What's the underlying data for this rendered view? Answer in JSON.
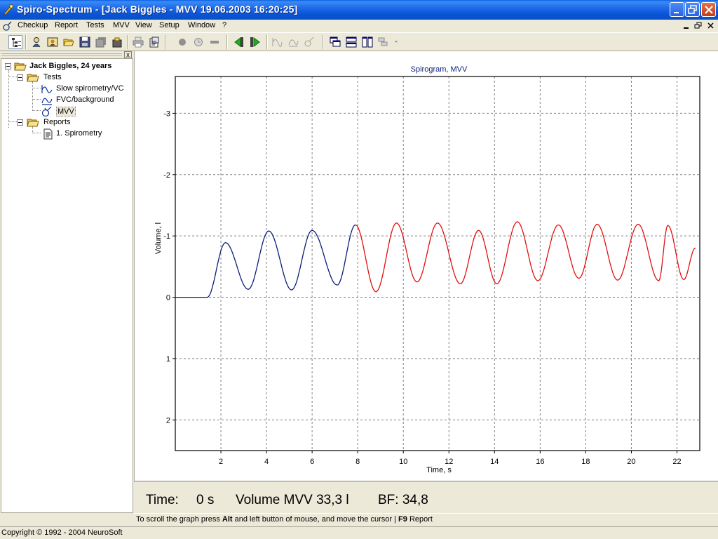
{
  "window": {
    "title": "Spiro-Spectrum - [Jack Biggles - MVV 19.06.2003 16:20:25]"
  },
  "menu": {
    "items": [
      "Checkup",
      "Report",
      "Tests",
      "MVV",
      "View",
      "Setup",
      "Window",
      "?"
    ]
  },
  "tree": {
    "patient": "Jack Biggles, 24 years",
    "tests_folder": "Tests",
    "tests": [
      "Slow spirometry/VC",
      "FVC/background",
      "MVV"
    ],
    "reports_folder": "Reports",
    "reports": [
      "1. Spirometry"
    ],
    "close_label": "x"
  },
  "chart_data": {
    "type": "line",
    "title": "Spirogram, MVV",
    "xlabel": "Time, s",
    "ylabel": "Volume, l",
    "x_ticks": [
      "2",
      "4",
      "6",
      "8",
      "10",
      "12",
      "14",
      "16",
      "18",
      "20",
      "22"
    ],
    "y_ticks": [
      "-3",
      "-2",
      "-1",
      "0",
      "1",
      "2"
    ],
    "xlim": [
      0,
      23
    ],
    "ylim": [
      2.5,
      -3.6
    ],
    "y_inverted": true,
    "grid": true,
    "colors": {
      "series1": "#0a1f7a",
      "series2": "#e01010",
      "title": "#0a1f7a"
    },
    "series": [
      {
        "points": [
          [
            0,
            0
          ],
          [
            1.4,
            0
          ],
          [
            2.2,
            -0.89
          ],
          [
            3.2,
            -0.13
          ],
          [
            4.1,
            -1.08
          ],
          [
            5.1,
            -0.12
          ],
          [
            6.0,
            -1.09
          ],
          [
            7.1,
            -0.2
          ],
          [
            7.9,
            -1.18
          ]
        ]
      },
      {
        "points": [
          [
            7.9,
            -1.18
          ],
          [
            8.8,
            -0.09
          ],
          [
            9.7,
            -1.21
          ],
          [
            10.6,
            -0.25
          ],
          [
            11.5,
            -1.21
          ],
          [
            12.5,
            -0.22
          ],
          [
            13.3,
            -1.09
          ],
          [
            14.1,
            -0.22
          ],
          [
            15.0,
            -1.23
          ],
          [
            15.9,
            -0.27
          ],
          [
            16.8,
            -1.18
          ],
          [
            17.7,
            -0.31
          ],
          [
            18.5,
            -1.19
          ],
          [
            19.4,
            -0.28
          ],
          [
            20.3,
            -1.19
          ],
          [
            21.2,
            -0.27
          ],
          [
            21.6,
            -1.17
          ],
          [
            22.3,
            -0.29
          ],
          [
            22.8,
            -0.8
          ]
        ]
      }
    ]
  },
  "readout": {
    "time_label": "Time:",
    "time_value": "0 s",
    "volume": "Volume MVV 33,3 l",
    "bf": "BF: 34,8"
  },
  "hint": {
    "prefix": "To scroll the graph press",
    "key1": "Alt",
    "middle": "and left button of mouse, and move the cursor |",
    "key2": "F9",
    "suffix": "Report"
  },
  "status": {
    "copyright": "Copyright © 1992 - 2004 NeuroSoft"
  }
}
